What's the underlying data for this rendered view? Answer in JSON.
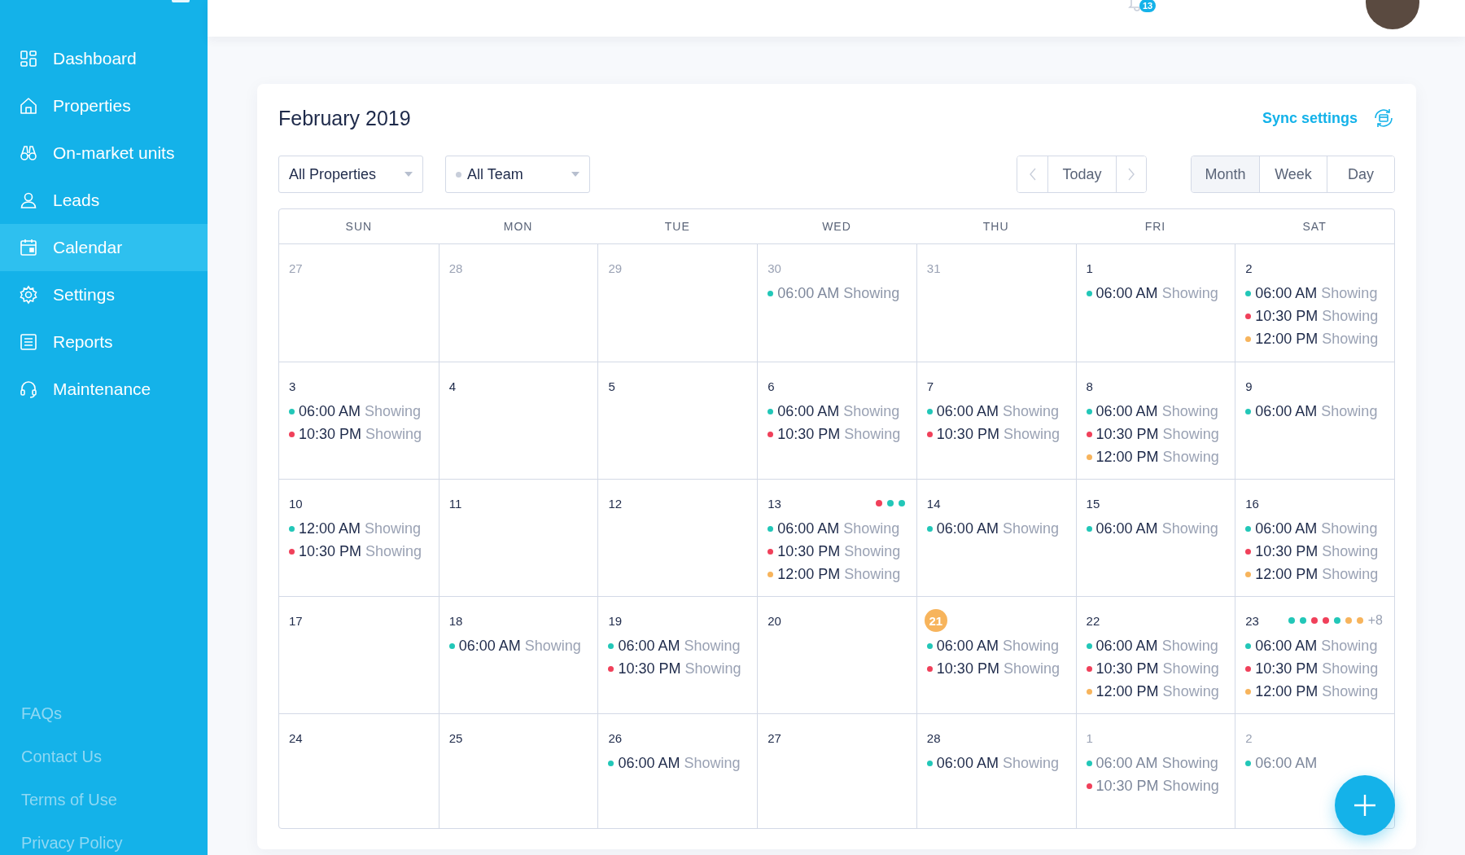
{
  "sidebar": {
    "items": [
      {
        "label": "Dashboard",
        "selected": false
      },
      {
        "label": "Properties",
        "selected": false
      },
      {
        "label": "On-market units",
        "selected": false
      },
      {
        "label": "Leads",
        "selected": false
      },
      {
        "label": "Calendar",
        "selected": true
      },
      {
        "label": "Settings",
        "selected": false
      },
      {
        "label": "Reports",
        "selected": false
      },
      {
        "label": "Maintenance",
        "selected": false
      }
    ],
    "footer_links": [
      "FAQs",
      "Contact Us",
      "Terms of Use",
      "Privacy Policy"
    ]
  },
  "topbar": {
    "notification_count": "13"
  },
  "calendar": {
    "title": "February 2019",
    "sync_label": "Sync settings",
    "filters": [
      {
        "value": "All Properties",
        "kind": "plain"
      },
      {
        "value": "All Team",
        "kind": "dot"
      }
    ],
    "nav": {
      "today": "Today"
    },
    "views": [
      {
        "label": "Month",
        "selected": true
      },
      {
        "label": "Week",
        "selected": false
      },
      {
        "label": "Day",
        "selected": false
      }
    ],
    "weekdays": [
      "SUN",
      "MON",
      "TUE",
      "WED",
      "THU",
      "FRI",
      "SAT"
    ],
    "weeks": [
      [
        {
          "day": "27",
          "muted": true
        },
        {
          "day": "28",
          "muted": true
        },
        {
          "day": "29",
          "muted": true
        },
        {
          "day": "30",
          "muted": true,
          "events": [
            {
              "time": "06:00 AM",
              "label": "Showing",
              "color": "#22c7b8"
            }
          ]
        },
        {
          "day": "31",
          "muted": true
        },
        {
          "day": "1",
          "muted": false,
          "events": [
            {
              "time": "06:00 AM",
              "label": "Showing",
              "color": "#22c7b8"
            }
          ]
        },
        {
          "day": "2",
          "muted": false,
          "events": [
            {
              "time": "06:00 AM",
              "label": "Showing",
              "color": "#22c7b8"
            },
            {
              "time": "10:30 PM",
              "label": "Showing",
              "color": "#f0405a"
            },
            {
              "time": "12:00 PM",
              "label": "Showing",
              "color": "#f7b45c"
            }
          ]
        }
      ],
      [
        {
          "day": "3",
          "muted": false,
          "events": [
            {
              "time": "06:00 AM",
              "label": "Showing",
              "color": "#22c7b8"
            },
            {
              "time": "10:30 PM",
              "label": "Showing",
              "color": "#f0405a"
            }
          ]
        },
        {
          "day": "4",
          "muted": false
        },
        {
          "day": "5",
          "muted": false
        },
        {
          "day": "6",
          "muted": false,
          "events": [
            {
              "time": "06:00 AM",
              "label": "Showing",
              "color": "#22c7b8"
            },
            {
              "time": "10:30 PM",
              "label": "Showing",
              "color": "#f0405a"
            }
          ]
        },
        {
          "day": "7",
          "muted": false,
          "events": [
            {
              "time": "06:00 AM",
              "label": "Showing",
              "color": "#22c7b8"
            },
            {
              "time": "10:30 PM",
              "label": "Showing",
              "color": "#f0405a"
            }
          ]
        },
        {
          "day": "8",
          "muted": false,
          "events": [
            {
              "time": "06:00 AM",
              "label": "Showing",
              "color": "#22c7b8"
            },
            {
              "time": "10:30 PM",
              "label": "Showing",
              "color": "#f0405a"
            },
            {
              "time": "12:00 PM",
              "label": "Showing",
              "color": "#f7b45c"
            }
          ]
        },
        {
          "day": "9",
          "muted": false,
          "events": [
            {
              "time": "06:00 AM",
              "label": "Showing",
              "color": "#22c7b8"
            }
          ]
        }
      ],
      [
        {
          "day": "10",
          "muted": false,
          "events": [
            {
              "time": "12:00 AM",
              "label": "Showing",
              "color": "#22c7b8"
            },
            {
              "time": "10:30 PM",
              "label": "Showing",
              "color": "#f0405a"
            }
          ]
        },
        {
          "day": "11",
          "muted": false
        },
        {
          "day": "12",
          "muted": false
        },
        {
          "day": "13",
          "muted": false,
          "dots": [
            {
              "color": "#f0405a"
            },
            {
              "color": "#22c7b8"
            },
            {
              "color": "#22c7b8"
            }
          ],
          "events": [
            {
              "time": "06:00 AM",
              "label": "Showing",
              "color": "#22c7b8"
            },
            {
              "time": "10:30 PM",
              "label": "Showing",
              "color": "#f0405a"
            },
            {
              "time": "12:00 PM",
              "label": "Showing",
              "color": "#f7b45c"
            }
          ]
        },
        {
          "day": "14",
          "muted": false,
          "events": [
            {
              "time": "06:00 AM",
              "label": "Showing",
              "color": "#22c7b8"
            }
          ]
        },
        {
          "day": "15",
          "muted": false,
          "events": [
            {
              "time": "06:00 AM",
              "label": "Showing",
              "color": "#22c7b8"
            }
          ]
        },
        {
          "day": "16",
          "muted": false,
          "events": [
            {
              "time": "06:00 AM",
              "label": "Showing",
              "color": "#22c7b8"
            },
            {
              "time": "10:30 PM",
              "label": "Showing",
              "color": "#f0405a"
            },
            {
              "time": "12:00 PM",
              "label": "Showing",
              "color": "#f7b45c"
            }
          ]
        }
      ],
      [
        {
          "day": "17",
          "muted": false
        },
        {
          "day": "18",
          "muted": false,
          "events": [
            {
              "time": "06:00 AM",
              "label": "Showing",
              "color": "#22c7b8"
            }
          ]
        },
        {
          "day": "19",
          "muted": false,
          "events": [
            {
              "time": "06:00 AM",
              "label": "Showing",
              "color": "#22c7b8"
            },
            {
              "time": "10:30 PM",
              "label": "Showing",
              "color": "#f0405a"
            }
          ]
        },
        {
          "day": "20",
          "muted": false
        },
        {
          "day": "21",
          "muted": false,
          "today": true,
          "events": [
            {
              "time": "06:00 AM",
              "label": "Showing",
              "color": "#22c7b8"
            },
            {
              "time": "10:30 PM",
              "label": "Showing",
              "color": "#f0405a"
            }
          ]
        },
        {
          "day": "22",
          "muted": false,
          "events": [
            {
              "time": "06:00 AM",
              "label": "Showing",
              "color": "#22c7b8"
            },
            {
              "time": "10:30 PM",
              "label": "Showing",
              "color": "#f0405a"
            },
            {
              "time": "12:00 PM",
              "label": "Showing",
              "color": "#f7b45c"
            }
          ]
        },
        {
          "day": "23",
          "muted": false,
          "dots": [
            {
              "color": "#22c7b8"
            },
            {
              "color": "#22c7b8"
            },
            {
              "color": "#f0405a"
            },
            {
              "color": "#f0405a"
            },
            {
              "color": "#22c7b8"
            },
            {
              "color": "#f7b45c"
            },
            {
              "color": "#f7b45c"
            }
          ],
          "more": "+8",
          "events": [
            {
              "time": "06:00 AM",
              "label": "Showing",
              "color": "#22c7b8"
            },
            {
              "time": "10:30 PM",
              "label": "Showing",
              "color": "#f0405a"
            },
            {
              "time": "12:00 PM",
              "label": "Showing",
              "color": "#f7b45c"
            }
          ]
        }
      ],
      [
        {
          "day": "24",
          "muted": false
        },
        {
          "day": "25",
          "muted": false
        },
        {
          "day": "26",
          "muted": false,
          "events": [
            {
              "time": "06:00 AM",
              "label": "Showing",
              "color": "#22c7b8"
            }
          ]
        },
        {
          "day": "27",
          "muted": false
        },
        {
          "day": "28",
          "muted": false,
          "events": [
            {
              "time": "06:00 AM",
              "label": "Showing",
              "color": "#22c7b8"
            }
          ]
        },
        {
          "day": "1",
          "muted": true,
          "events": [
            {
              "time": "06:00 AM",
              "label": "Showing",
              "color": "#22c7b8"
            },
            {
              "time": "10:30 PM",
              "label": "Showing",
              "color": "#f0405a"
            }
          ]
        },
        {
          "day": "2",
          "muted": true,
          "events": [
            {
              "time": "06:00 AM",
              "color": "#22c7b8"
            }
          ]
        }
      ]
    ]
  }
}
